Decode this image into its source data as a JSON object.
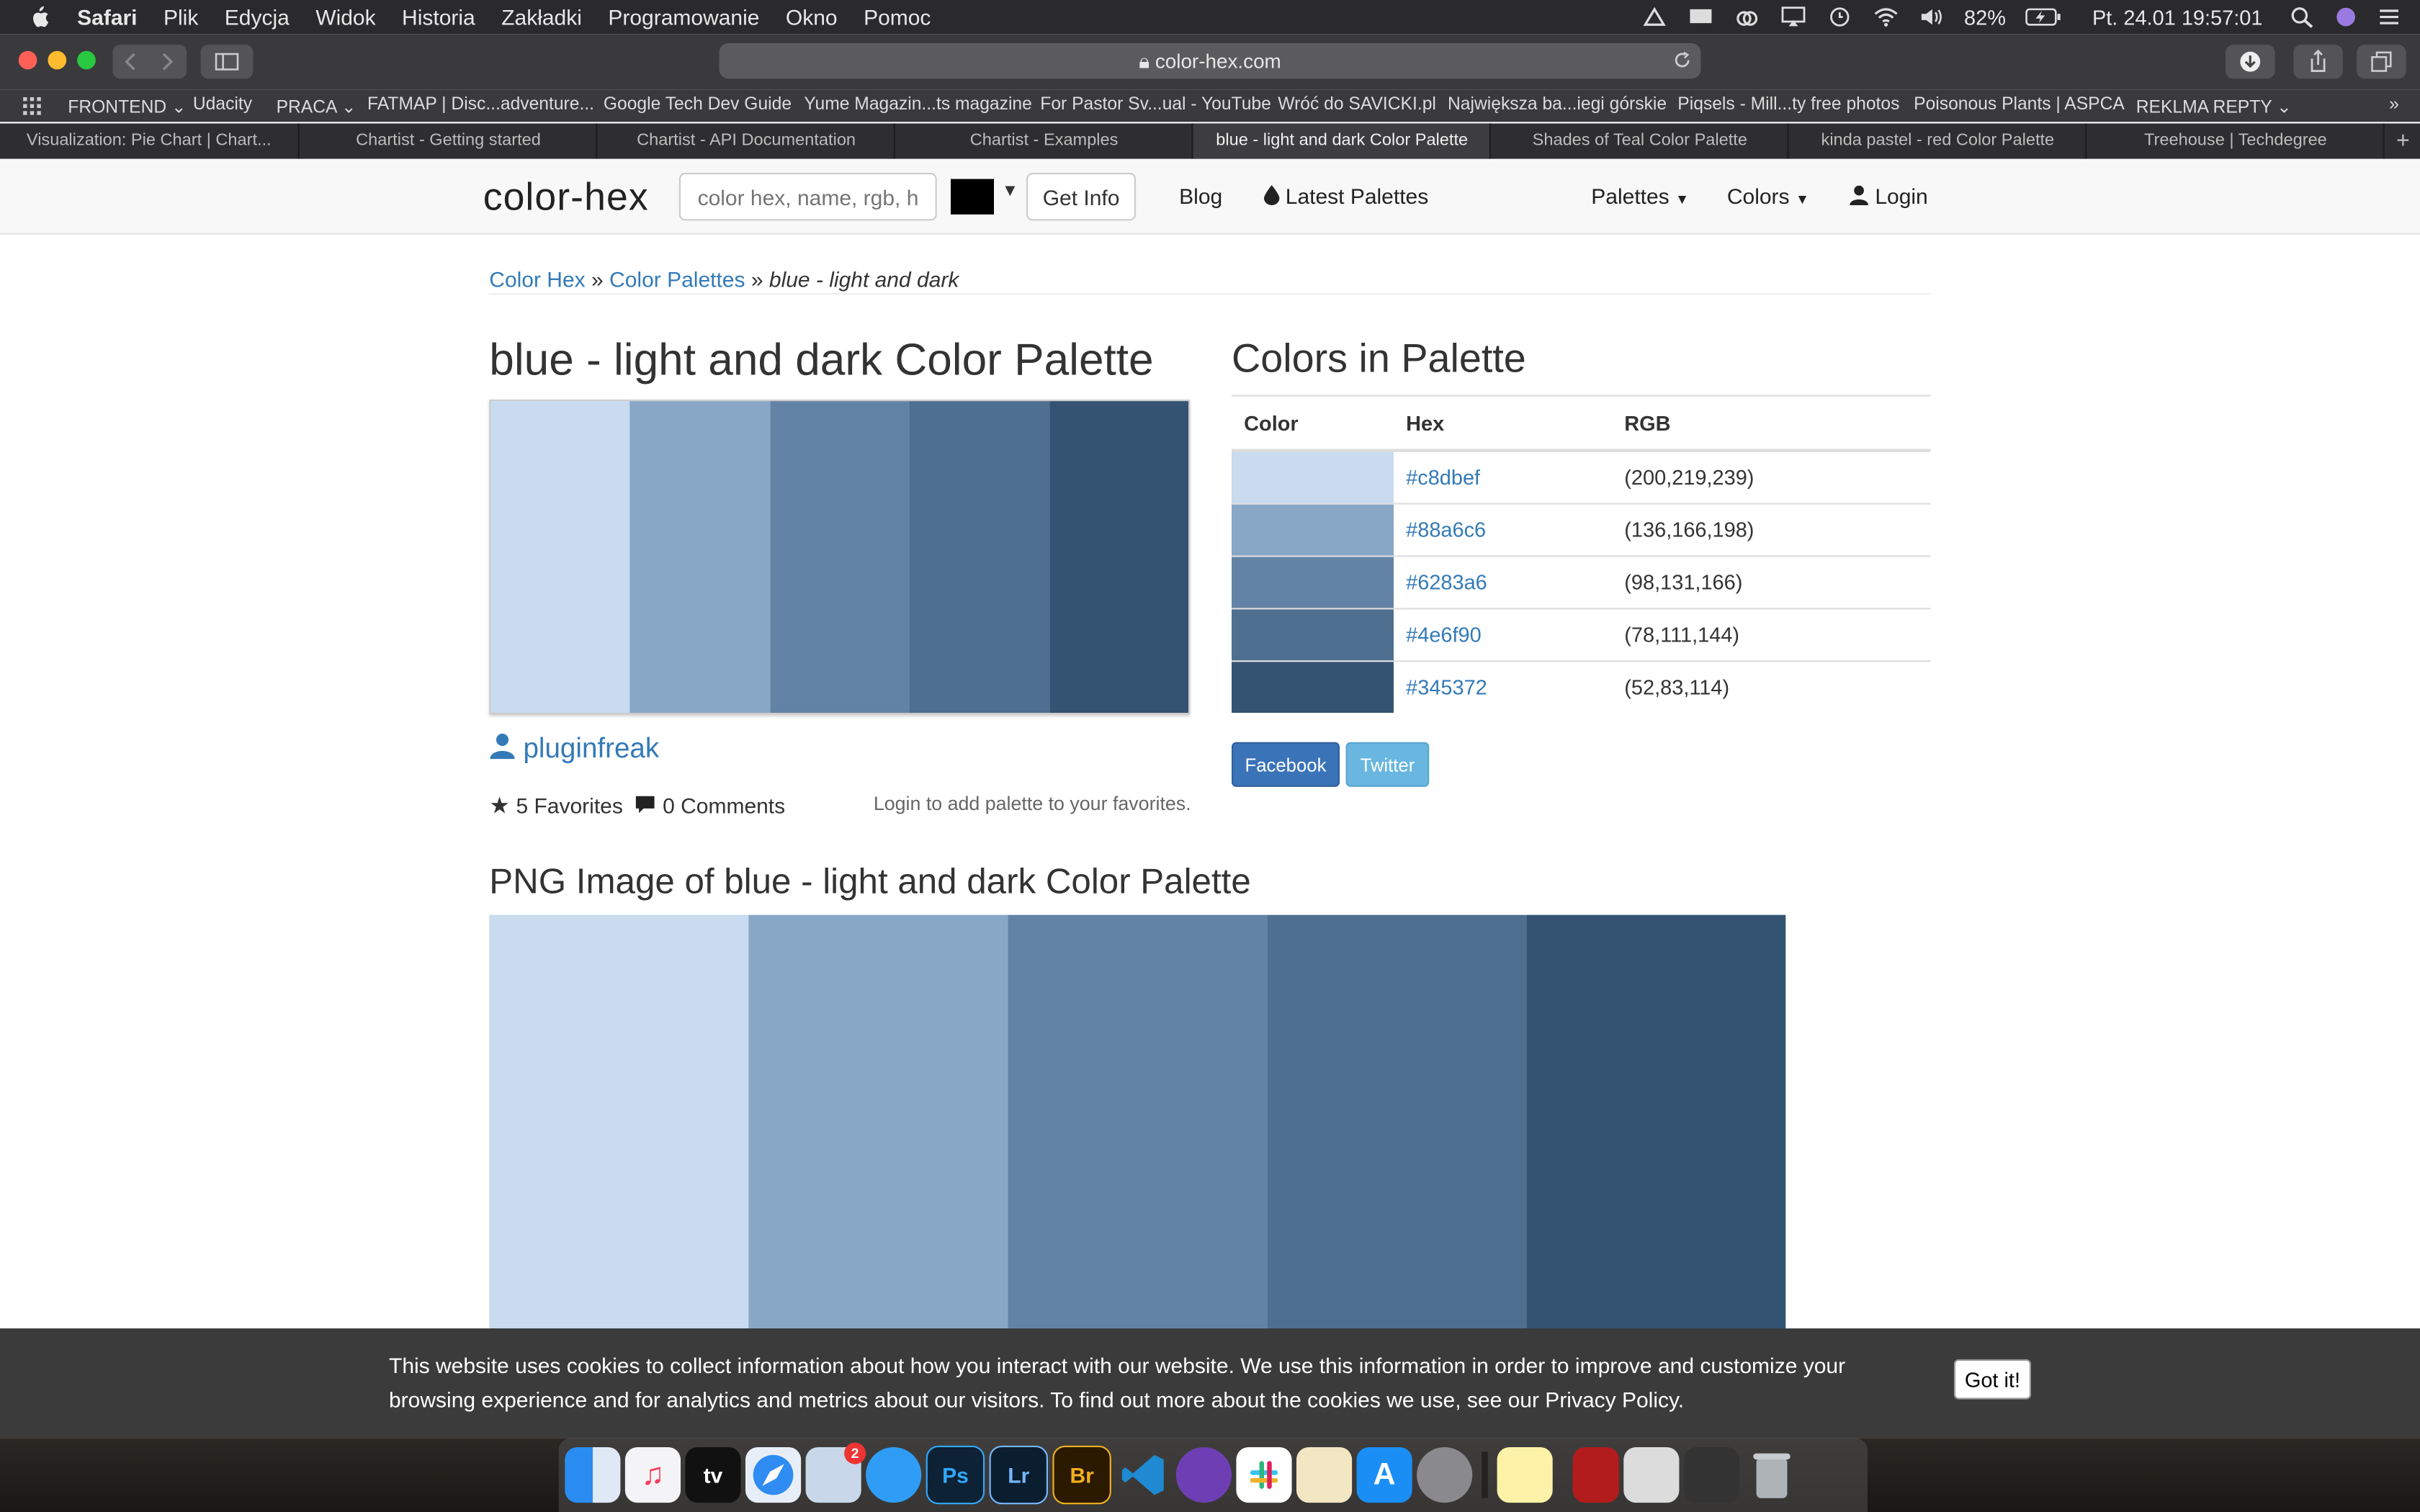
{
  "menubar": {
    "app": "Safari",
    "items": [
      "Plik",
      "Edycja",
      "Widok",
      "Historia",
      "Zakładki",
      "Programowanie",
      "Okno",
      "Pomoc"
    ],
    "battery": "82%",
    "datetime": "Pt. 24.01  19:57:01"
  },
  "browser": {
    "url": "color-hex.com",
    "bookmarks": [
      "FRONTEND",
      "Udacity",
      "PRACA",
      "FATMAP | Disc...adventure...",
      "Google Tech Dev Guide",
      "Yume Magazin...ts magazine",
      "For Pastor Sv...ual - YouTube",
      "Wróć do SAVICKI.pl",
      "Największa ba...iegi górskie",
      "Piqsels - Mill...ty free photos",
      "Poisonous Plants | ASPCA",
      "REKLMA REPTY"
    ],
    "tabs": [
      "Visualization: Pie Chart  |  Chart...",
      "Chartist - Getting started",
      "Chartist - API Documentation",
      "Chartist - Examples",
      "blue - light and dark Color Palette",
      "Shades of Teal Color Palette",
      "kinda pastel - red Color Palette",
      "Treehouse | Techdegree"
    ],
    "active_tab": 4
  },
  "nav": {
    "logo": "color-hex",
    "search_placeholder": "color hex, name, rgb, hsl",
    "get_info": "Get Info",
    "blog": "Blog",
    "latest": "Latest Palettes",
    "palettes": "Palettes",
    "colors": "Colors",
    "login": "Login"
  },
  "page": {
    "crumb1": "Color Hex",
    "crumb2": "Color Palettes",
    "crumb3": "blue - light and dark",
    "title": "blue - light and dark Color Palette",
    "author": "pluginfreak",
    "favorites": "5 Favorites",
    "comments": "0 Comments",
    "login_note": "Login to add palette to your favorites.",
    "colors_heading": "Colors in Palette",
    "table_headers": [
      "Color",
      "Hex",
      "RGB"
    ],
    "colors": [
      {
        "hex": "#c8dbef",
        "rgb": "(200,219,239)"
      },
      {
        "hex": "#88a6c6",
        "rgb": "(136,166,198)"
      },
      {
        "hex": "#6283a6",
        "rgb": "(98,131,166)"
      },
      {
        "hex": "#4e6f90",
        "rgb": "(78,111,144)"
      },
      {
        "hex": "#345372",
        "rgb": "(52,83,114)"
      }
    ],
    "facebook": "Facebook",
    "twitter": "Twitter",
    "png_heading": "PNG Image of blue - light and dark Color Palette"
  },
  "cookie": {
    "text": "This website uses cookies to collect information about how you interact with our website. We use this information in order to improve and customize your browsing experience and for analytics and metrics about our visitors. To find out more about the cookies we use, see our Privacy Policy.",
    "button": "Got it!"
  },
  "dock": {
    "icons": [
      "finder-icon",
      "music-icon",
      "tv-icon",
      "safari-icon",
      "mail-icon",
      "messages-icon",
      "photoshop-icon",
      "lightroom-icon",
      "bridge-icon",
      "vscode-icon",
      "github-icon",
      "slack-icon",
      "textedit-icon",
      "appstore-icon",
      "settings-icon",
      "terminal-icon",
      "notes-icon",
      "acrobat-icon",
      "preview-icon",
      "screenshot-icon",
      "trash-icon"
    ],
    "labels": {
      "ps": "Ps",
      "lr": "Lr",
      "br": "Br",
      "tv": "tv"
    },
    "badge": "2"
  }
}
